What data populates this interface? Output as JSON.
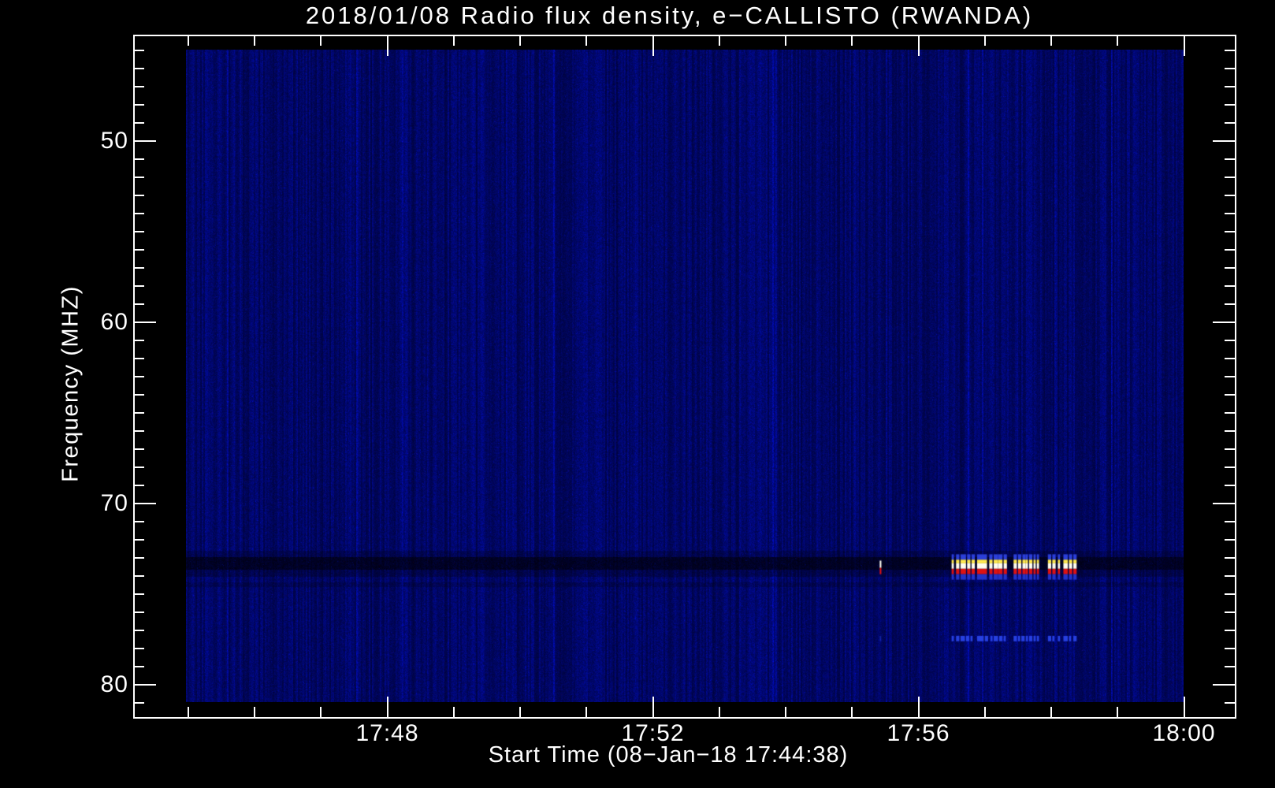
{
  "window": {
    "background": "#000000",
    "kind": "e-CALLISTO quicklook spectrogram plot"
  },
  "chart_data": {
    "type": "heatmap",
    "title": "2018/01/08  Radio flux density, e−CALLISTO (RWANDA)",
    "xlabel": "Start Time (08−Jan−18 17:44:38)",
    "ylabel": "Frequency (MHZ)",
    "station": "e-CALLISTO (RWANDA)",
    "date": "2018/01/08",
    "grid": false,
    "legend": "none",
    "x_axis": {
      "start_time": "17:44:38",
      "major_ticks": [
        {
          "label": "17:48",
          "minutes": 4
        },
        {
          "label": "17:52",
          "minutes": 8
        },
        {
          "label": "17:56",
          "minutes": 12
        },
        {
          "label": "18:00",
          "minutes": 16
        }
      ],
      "minor_tick_every_minutes": 1,
      "visible_tick_range_minutes": [
        1,
        16
      ],
      "data_range_minutes": [
        0.97,
        16.0
      ]
    },
    "y_axis": {
      "unit": "MHz",
      "direction": "increasing-downward",
      "major_ticks": [
        {
          "label": "50",
          "mhz": 50
        },
        {
          "label": "60",
          "mhz": 60
        },
        {
          "label": "70",
          "mhz": 70
        },
        {
          "label": "80",
          "mhz": 80
        }
      ],
      "minor_tick_every_mhz": 1,
      "visible_tick_range_mhz": [
        45,
        81
      ],
      "data_range_mhz": [
        44.96,
        80.96
      ]
    },
    "colors": {
      "frame": "#ffffff",
      "text": "#ffffff",
      "noise_base": "#00006b",
      "rfi_band": "#000018",
      "burst_blue_cap": "#2b3fd8",
      "burst_yellow": "#ffe94e",
      "burst_core_white": "#fffdee",
      "burst_red": "#dd1212",
      "burst_blue_base": "#2333c8",
      "harmonic_blue": "#2640e0"
    },
    "features": [
      {
        "name": "rfi-dark-band",
        "freq_mhz": [
          72.95,
          73.62
        ],
        "time": "entire record",
        "desc": "dark streaky interference band across full duration"
      },
      {
        "name": "faint-dark-line",
        "freq_mhz": 74.45,
        "time": "entire record",
        "desc": "very faint darker line"
      },
      {
        "name": "radio-burst-fundamental",
        "freq_mhz": [
          72.8,
          74.2
        ],
        "time": [
          "17:56:30",
          "17:58:23"
        ],
        "desc": "bright saturated burst segments (white/yellow core, red lower edge, blue fringes)"
      },
      {
        "name": "radio-burst-second-band",
        "freq_mhz": [
          77.3,
          77.6
        ],
        "time": [
          "17:56:30",
          "17:58:23"
        ],
        "desc": "row of bright blue dashes"
      },
      {
        "name": "isolated-spike",
        "freq_mhz": [
          73.15,
          73.9
        ],
        "time": "17:55:25",
        "desc": "single narrow bright spike"
      }
    ],
    "burst": {
      "bands_mhz": {
        "cap": [
          72.8,
          73.1
        ],
        "yellow": [
          73.1,
          73.3
        ],
        "core": [
          73.3,
          73.6
        ],
        "red": [
          73.6,
          73.9
        ],
        "base": [
          73.9,
          74.2
        ]
      },
      "bars_sec_after_1744": [
        [
          750,
          2
        ],
        [
          754,
          3
        ],
        [
          758,
          5
        ],
        [
          764,
          3
        ],
        [
          768,
          3
        ],
        [
          773,
          9
        ],
        [
          784,
          3
        ],
        [
          788,
          4
        ],
        [
          792,
          4
        ],
        [
          797,
          3
        ],
        [
          806,
          3
        ],
        [
          810,
          3
        ],
        [
          814,
          3
        ],
        [
          817,
          2
        ],
        [
          820,
          3
        ],
        [
          824,
          2
        ],
        [
          827,
          2
        ],
        [
          837,
          3
        ],
        [
          841,
          3
        ],
        [
          846,
          2
        ],
        [
          851,
          4
        ],
        [
          856,
          3
        ],
        [
          860,
          3
        ]
      ],
      "spike_sec_after_1744": [
        685,
        1.5
      ],
      "harmonic_band_mhz": [
        77.3,
        77.6
      ],
      "harmonic_dashes_sec_after_1744": [
        [
          750,
          2
        ],
        [
          754,
          3
        ],
        [
          758,
          4
        ],
        [
          763,
          3
        ],
        [
          767,
          2
        ],
        [
          773,
          6
        ],
        [
          780,
          3
        ],
        [
          785,
          2
        ],
        [
          788,
          4
        ],
        [
          793,
          3
        ],
        [
          797,
          2
        ],
        [
          806,
          3
        ],
        [
          810,
          2
        ],
        [
          813,
          3
        ],
        [
          817,
          2
        ],
        [
          820,
          3
        ],
        [
          824,
          2
        ],
        [
          827,
          2
        ],
        [
          837,
          3
        ],
        [
          841,
          2
        ],
        [
          846,
          2
        ],
        [
          851,
          4
        ],
        [
          856,
          2
        ],
        [
          860,
          3
        ]
      ]
    }
  }
}
